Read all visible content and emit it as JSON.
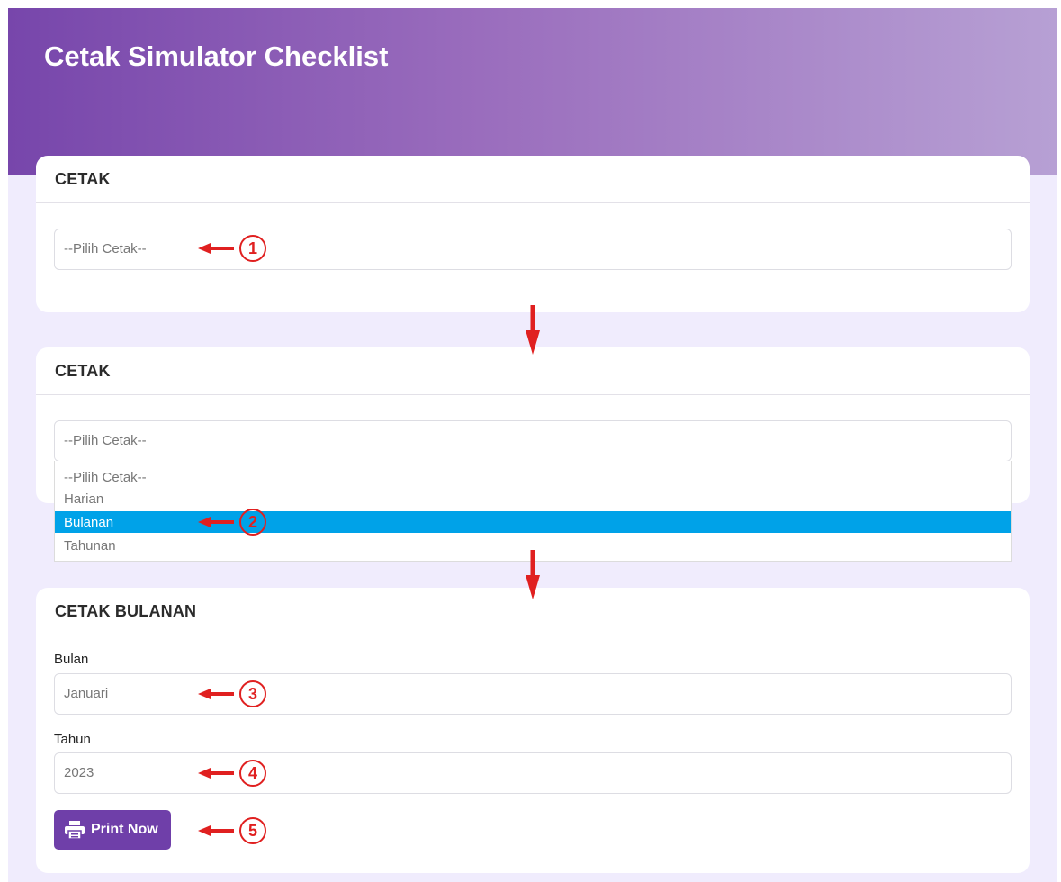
{
  "header": {
    "title": "Cetak Simulator Checklist"
  },
  "card1": {
    "title": "CETAK",
    "select_value": "--Pilih Cetak--"
  },
  "card2": {
    "title": "CETAK",
    "select_value": "--Pilih Cetak--",
    "options": [
      "--Pilih Cetak--",
      "Harian",
      "Bulanan",
      "Tahunan"
    ],
    "highlighted_option": "Bulanan"
  },
  "card3": {
    "title": "CETAK BULANAN",
    "bulan_label": "Bulan",
    "bulan_value": "Januari",
    "tahun_label": "Tahun",
    "tahun_value": "2023",
    "print_label": "Print Now"
  },
  "annotations": {
    "steps": [
      "1",
      "2",
      "3",
      "4",
      "5"
    ],
    "color": "#e02020"
  },
  "colors": {
    "accent": "#6f3fa9",
    "highlight": "#00a2e8",
    "background": "#f0ecfd"
  }
}
